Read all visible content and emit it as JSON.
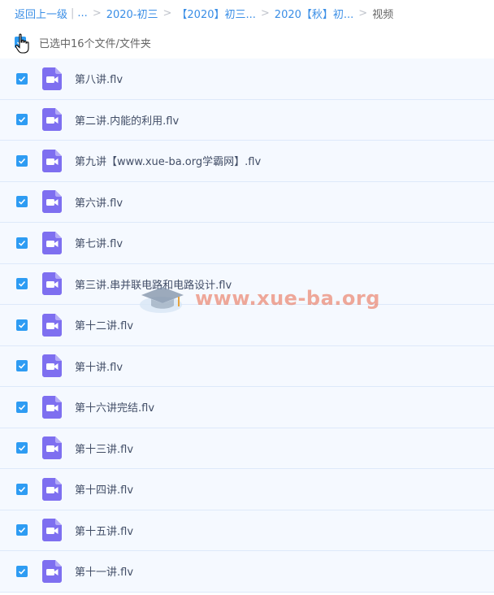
{
  "breadcrumb": {
    "back": "返回上一级",
    "ellipsis": "...",
    "items": [
      "2020-初三",
      "【2020】初三...",
      "2020【秋】初..."
    ],
    "current": "视频"
  },
  "selection": {
    "text": "已选中16个文件/文件夹"
  },
  "files": [
    "第八讲.flv",
    "第二讲.内能的利用.flv",
    "第九讲【www.xue-ba.org学霸网】.flv",
    "第六讲.flv",
    "第七讲.flv",
    "第三讲.串并联电路和电路设计.flv",
    "第十二讲.flv",
    "第十讲.flv",
    "第十六讲完结.flv",
    "第十三讲.flv",
    "第十四讲.flv",
    "第十五讲.flv",
    "第十一讲.flv"
  ],
  "watermark": {
    "text": "www.xue-ba.org"
  },
  "colors": {
    "accent": "#2e9cf3",
    "video_icon": "#7e6ff0",
    "row_bg": "#f5f9ff"
  },
  "icons": {
    "file": "video-file-icon",
    "checkbox": "checkbox-checked-icon"
  }
}
